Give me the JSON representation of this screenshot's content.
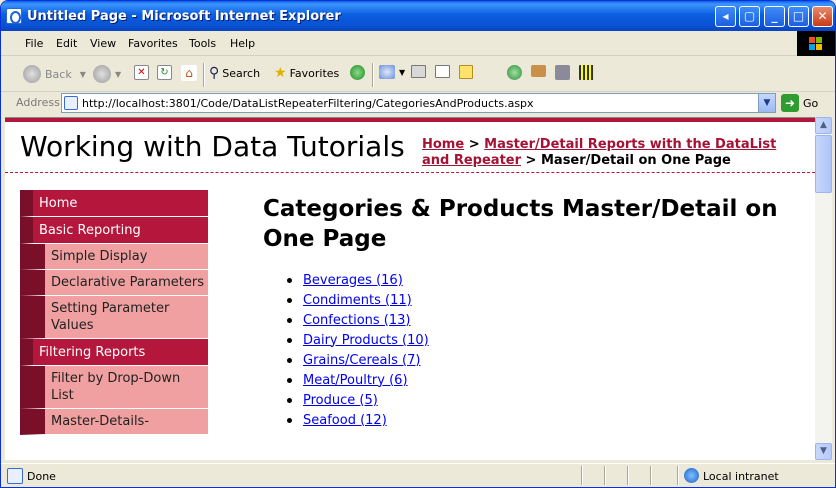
{
  "window": {
    "title": "Untitled Page - Microsoft Internet Explorer"
  },
  "menu": [
    "File",
    "Edit",
    "View",
    "Favorites",
    "Tools",
    "Help"
  ],
  "toolbar": {
    "back": "Back",
    "search": "Search",
    "favorites": "Favorites"
  },
  "address": {
    "label": "Address",
    "url": "http://localhost:3801/Code/DataListRepeaterFiltering/CategoriesAndProducts.aspx",
    "go": "Go"
  },
  "site": {
    "title": "Working with Data Tutorials"
  },
  "breadcrumb": {
    "home": "Home",
    "sep1": " > ",
    "parent": "Master/Detail Reports with the DataList and Repeater",
    "sep2": " > ",
    "current": "Maser/Detail on One Page"
  },
  "sidebar": [
    {
      "label": "Home",
      "level": 1
    },
    {
      "label": "Basic Reporting",
      "level": 1
    },
    {
      "label": "Simple Display",
      "level": 2
    },
    {
      "label": "Declarative Parameters",
      "level": 2
    },
    {
      "label": "Setting Parameter Values",
      "level": 2
    },
    {
      "label": "Filtering Reports",
      "level": 1
    },
    {
      "label": "Filter by Drop-Down List",
      "level": 2
    },
    {
      "label": "Master-Details-",
      "level": 2
    }
  ],
  "page": {
    "heading": "Categories & Products Master/Detail on One Page"
  },
  "categories": [
    "Beverages (16)",
    "Condiments (11)",
    "Confections (13)",
    "Dairy Products (10)",
    "Grains/Cereals (7)",
    "Meat/Poultry (6)",
    "Produce (5)",
    "Seafood (12)"
  ],
  "status": {
    "text": "Done",
    "zone": "Local intranet"
  },
  "colors": {
    "accent": "#b5173c",
    "sidebar_dark": "#7a0f2a",
    "sidebar_light": "#f0a0a0",
    "link": "#0000ee"
  }
}
